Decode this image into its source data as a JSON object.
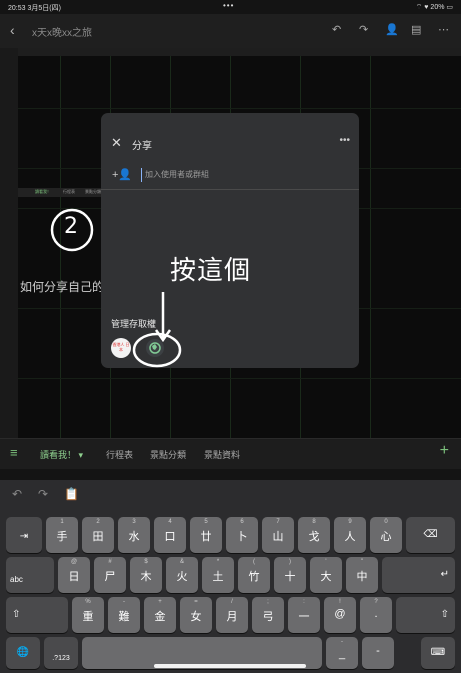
{
  "status": {
    "time": "20:53",
    "date": "3月5日(四)",
    "dots": "•••",
    "battery": "20%"
  },
  "toolbar": {
    "back": "‹",
    "title": "x天x晚xx之旅",
    "icons": [
      "undo-icon",
      "redo-icon",
      "add-person-icon",
      "comment-icon",
      "more-icon"
    ]
  },
  "sheet": {
    "minitabs": [
      "讀看我！",
      "行程表",
      "景點分類"
    ],
    "howto_text": "如何分享自己的"
  },
  "dialog": {
    "close": "✕",
    "title": "分享",
    "more": "•••",
    "add_placeholder": "加入使用者或群組",
    "manage_label": "管理存取權",
    "badge_text": "香港人 日本"
  },
  "annotation": {
    "circled_number": "2",
    "handwritten": "按這個"
  },
  "tabs": {
    "items": [
      "讀看我！",
      "行程表",
      "景點分類",
      "景點資料"
    ],
    "active": 0
  },
  "keyboard": {
    "row1": [
      {
        "sub": "1",
        "main": "手"
      },
      {
        "sub": "2",
        "main": "田"
      },
      {
        "sub": "3",
        "main": "水"
      },
      {
        "sub": "4",
        "main": "口"
      },
      {
        "sub": "5",
        "main": "廿"
      },
      {
        "sub": "6",
        "main": "卜"
      },
      {
        "sub": "7",
        "main": "山"
      },
      {
        "sub": "8",
        "main": "戈"
      },
      {
        "sub": "9",
        "main": "人"
      },
      {
        "sub": "0",
        "main": "心"
      }
    ],
    "row2": [
      {
        "sub": "@",
        "main": "日"
      },
      {
        "sub": "#",
        "main": "尸"
      },
      {
        "sub": "$",
        "main": "木"
      },
      {
        "sub": "&",
        "main": "火"
      },
      {
        "sub": "*",
        "main": "土"
      },
      {
        "sub": "(",
        "main": "竹"
      },
      {
        "sub": ")",
        "main": "十"
      },
      {
        "sub": "'",
        "main": "大"
      },
      {
        "sub": "\"",
        "main": "中"
      }
    ],
    "row3": [
      {
        "sub": "%",
        "main": "重"
      },
      {
        "sub": "-",
        "main": "難"
      },
      {
        "sub": "+",
        "main": "金"
      },
      {
        "sub": "=",
        "main": "女"
      },
      {
        "sub": "/",
        "main": "月"
      },
      {
        "sub": ";",
        "main": "弓"
      },
      {
        "sub": ":",
        "main": "一"
      },
      {
        "sub": "!",
        "main": "@"
      },
      {
        "sub": "?",
        "main": "."
      }
    ],
    "abc": "abc",
    "num": ".?123",
    "dash_sub": "-",
    "dash_main": "_",
    "tab_icon": "⇥",
    "backspace_icon": "⌫",
    "return_icon": "↵",
    "shift_icon": "⇧",
    "globe_icon": "🌐",
    "hide_icon": "⌨"
  }
}
